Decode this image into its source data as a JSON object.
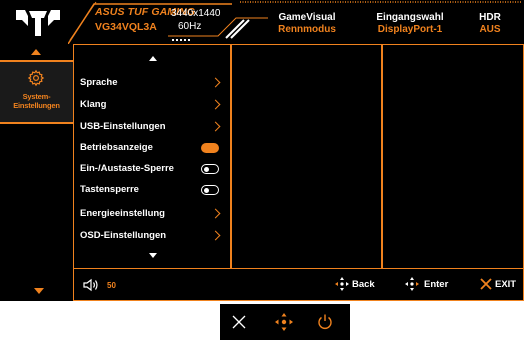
{
  "header": {
    "model_line1": "ASUS TUF GAMING",
    "model_line2": "VG34VQL3A",
    "resolution": "3440x1440",
    "refresh": "60Hz",
    "columns": [
      {
        "title": "GameVisual",
        "value": "Rennmodus"
      },
      {
        "title": "Eingangswahl",
        "value": "DisplayPort-1"
      },
      {
        "title": "HDR",
        "value": "AUS"
      }
    ]
  },
  "sidebar": {
    "selected_label": "System-Einstellungen"
  },
  "menu": {
    "items": [
      {
        "label": "Sprache",
        "control": "chevron"
      },
      {
        "label": "Klang",
        "control": "chevron"
      },
      {
        "label": "USB-Einstellungen",
        "control": "chevron"
      },
      {
        "label": "Betriebsanzeige",
        "control": "toggle-on"
      },
      {
        "label": "Ein-/Austaste-Sperre",
        "control": "toggle-off"
      },
      {
        "label": "Tastensperre",
        "control": "toggle-off"
      },
      {
        "label": "Energieeinstellung",
        "control": "chevron"
      },
      {
        "label": "OSD-Einstellungen",
        "control": "chevron"
      }
    ]
  },
  "footer": {
    "volume_icon": "speaker-icon",
    "volume": "50",
    "back_label": "Back",
    "enter_label": "Enter",
    "exit_label": "EXIT"
  },
  "colors": {
    "accent": "#f0821e",
    "background": "#000000"
  }
}
